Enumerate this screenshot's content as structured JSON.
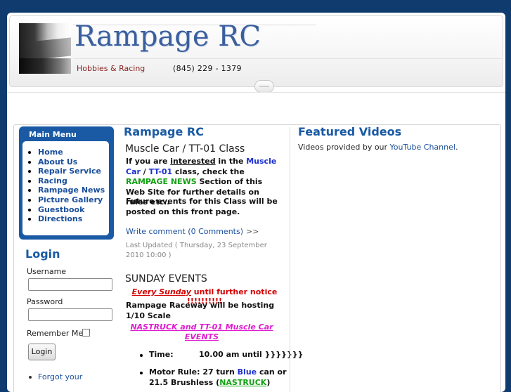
{
  "header": {
    "site_title": "Rampage RC",
    "tagline": "Hobbies & Racing",
    "phone": "(845) 229 - 1379"
  },
  "main_menu": {
    "title": "Main Menu",
    "items": [
      "Home",
      "About Us",
      "Repair Service",
      "Racing",
      "Rampage News",
      "Picture Gallery",
      "Guestbook",
      "Directions"
    ]
  },
  "login": {
    "title": "Login",
    "username_label": "Username",
    "username_value": "",
    "password_label": "Password",
    "password_value": "",
    "remember_label": "Remember Me",
    "button_label": "Login",
    "forgot_link": "Forgot your"
  },
  "center": {
    "title": "Rampage RC",
    "article1": {
      "title": "Muscle Car / TT-01 Class",
      "p1_a": "If you are ",
      "p1_interested": "interested",
      "p1_b": " in the ",
      "p1_muscle": "Muscle Car",
      "p1_slash": " / ",
      "p1_tt": "TT-01",
      "p1_c": " class, check the ",
      "p1_news": "RAMPAGE NEWS",
      "p1_d": " Section of this Web Site for further details on rules etc..",
      "p2": "Future events for this Class will be posted on this front page.",
      "read_more": "Write comment (0 Comments)",
      "read_more_arrow": ">>",
      "updated": "Last Updated ( Thursday, 23 September 2010 10:00 )"
    },
    "article2": {
      "title": "SUNDAY EVENTS",
      "every_sunday": "Every Sunday",
      "until_notice": " until further notice !!!!!!!!!!",
      "hosting": "Rampage Raceway will be hosting 1/10 Scale",
      "nastruck_line": "NASTRUCK and TT-01 Muscle Car EVENTS",
      "time_label": "Time:",
      "time_value": "10.00 am until }}}}}}}",
      "motor_label": "Motor Rule:",
      "motor_a": "27 turn ",
      "motor_blue": "Blue",
      "motor_b": " can or 21.5 Brushless ",
      "motor_paren_open": "(",
      "motor_nastruck": "NASTRUCK",
      "motor_paren_close": ")"
    }
  },
  "featured": {
    "title": "Featured Videos",
    "text_a": "Videos provided by our ",
    "link": "YouTube Channel",
    "text_b": "."
  }
}
